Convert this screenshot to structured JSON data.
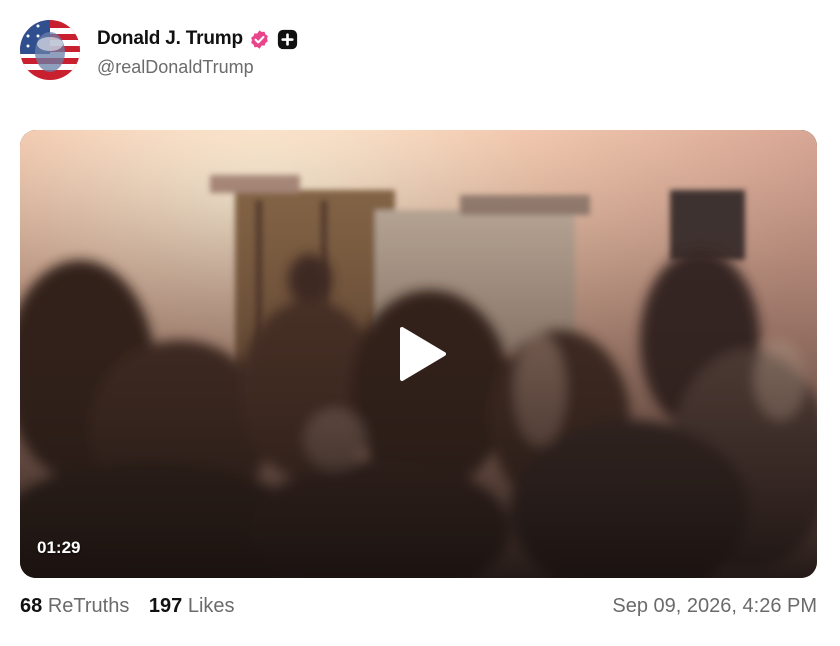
{
  "author": {
    "display_name": "Donald J. Trump",
    "handle": "@realDonaldTrump",
    "verified_color": "#e8458b"
  },
  "media": {
    "duration": "01:29",
    "icon": "play-icon"
  },
  "stats": {
    "retruths_count": "68",
    "retruths_label": "ReTruths",
    "likes_count": "197",
    "likes_label": "Likes"
  },
  "timestamp": "Sep 09, 2026, 4:26 PM"
}
